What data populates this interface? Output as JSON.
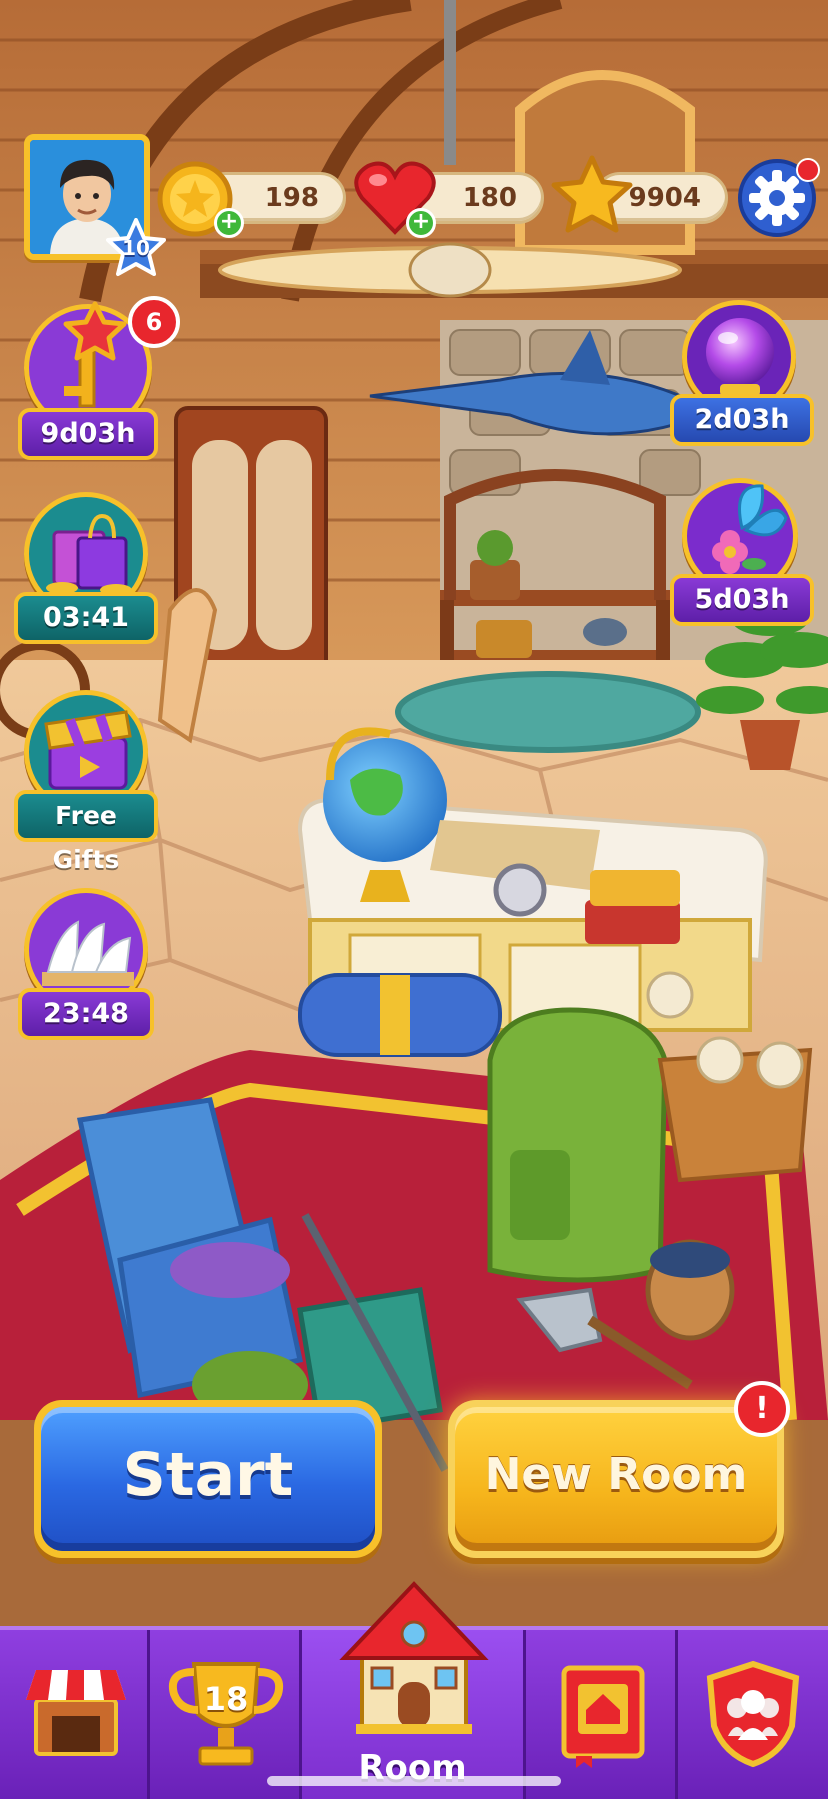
{
  "hud": {
    "player_level": "10",
    "coins": "198",
    "lives": "180",
    "stars": "9904",
    "settings_icon": "gear-icon"
  },
  "events": [
    {
      "name": "key-event",
      "timer": "9d03h",
      "badge": "6",
      "icon": "star-key-icon"
    },
    {
      "name": "shopping-offer",
      "timer": "03:41",
      "icon": "shopping-bag-icon"
    },
    {
      "name": "free-gifts",
      "label": "Free Gifts",
      "icon": "gift-box-icon"
    },
    {
      "name": "sydney-event",
      "timer": "23:48",
      "icon": "opera-house-icon"
    },
    {
      "name": "crystal-ball-event",
      "timer": "2d03h",
      "icon": "crystal-ball-icon"
    },
    {
      "name": "butterfly-event",
      "timer": "5d03h",
      "icon": "butterfly-flower-icon"
    }
  ],
  "buttons": {
    "start": "Start",
    "new_room": "New Room",
    "new_room_alert": "!"
  },
  "bottom_nav": {
    "shop_icon": "shop-icon",
    "trophy_rank": "18",
    "room_label": "Room",
    "album_icon": "book-icon",
    "team_icon": "team-shield-icon"
  },
  "colors": {
    "gold_frame": "#f7c12a",
    "start_blue": "#2a68e2",
    "new_room_yellow": "#f6b51c",
    "nav_purple": "#7b2ccc",
    "badge_red": "#e8262d"
  }
}
